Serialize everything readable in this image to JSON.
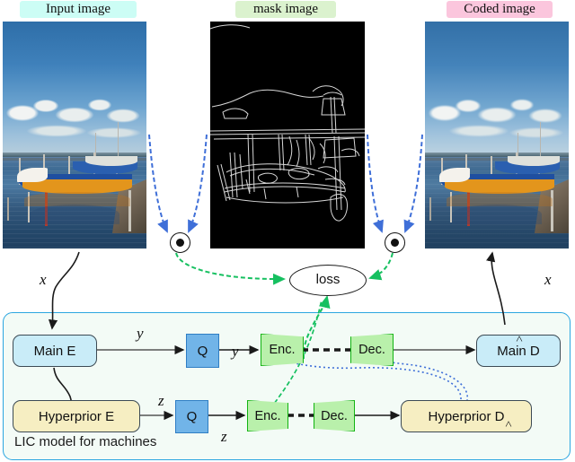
{
  "captions": {
    "input": {
      "text": "Input image",
      "color": "#ccfdf5"
    },
    "mask": {
      "text": "mask image",
      "color": "#dbf2ce"
    },
    "coded": {
      "text": "Coded image",
      "color": "#fbc6dd"
    }
  },
  "diagram": {
    "container_label": "LIC model for machines",
    "container_border_color": "#2ba6e0",
    "loss_label": "loss",
    "blocks": {
      "main_e": "Main E",
      "main_d": "Main D",
      "hyper_e": "Hyperprior E",
      "hyper_d": "Hyperprior D",
      "q1": "Q",
      "q2": "Q",
      "enc_top": "Enc.",
      "dec_top": "Dec.",
      "enc_bottom": "Enc.",
      "dec_bottom": "Dec."
    },
    "variables": {
      "x": "x",
      "x_hat": "x",
      "y": "y",
      "y_hat": "y",
      "z": "z",
      "z_hat": "z"
    },
    "colors": {
      "main_block": "#c9ecf8",
      "hyper_block": "#f6eec2",
      "quantizer": "#71b4e8",
      "codec": "#b9f0ab",
      "codec_border": "#12b312",
      "loss_arrow": "#16c060",
      "feature_arrow": "#3f6fd8",
      "bitstream": "#1a1a1a"
    }
  }
}
